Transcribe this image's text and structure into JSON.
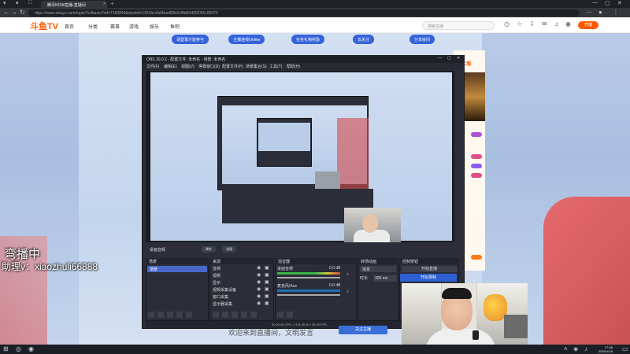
{
  "browser": {
    "tab_title": "腾讯NOW直播-直播间",
    "url": "https://www.douyu.com/topic/Yulibaxiu?rid=7183849&dyshid=1261bcc5d4bad92b2e9fd60d0023f1c00070",
    "new_tab_symbol": "+",
    "close_symbol": "×"
  },
  "site": {
    "logo": "斗鱼TV",
    "nav": [
      "首页",
      "分类",
      "赛事",
      "游戏",
      "娱乐",
      "鱼吧"
    ],
    "search_placeholder": "搜索主播",
    "live_button": "开播"
  },
  "room_tabs": [
    "请登录才能参与",
    "主播连线Online",
    "任务礼物奖励",
    "去关注",
    "分享房间"
  ],
  "right_panel": {
    "pc_label": "PC版"
  },
  "overlay": {
    "line1": "弯播中",
    "line2": "助理v：xiaozhuli66888"
  },
  "bottom": {
    "text": "欢迎来到直播间，文明发言",
    "button": "关注主播"
  },
  "obs": {
    "title": "OBS 30.0.2 - 配置文件: 未命名 - 场景: 未命名",
    "menu": [
      "文件(F)",
      "编辑(E)",
      "视图(V)",
      "停靠窗口(D)",
      "配置文件(P)",
      "场景集合(S)",
      "工具(T)",
      "帮助(H)"
    ],
    "strip_label": "桌面音频",
    "strip_buttons": [
      "属性",
      "滤镜"
    ],
    "docks": {
      "scenes": {
        "title": "场景",
        "items": [
          "场景"
        ]
      },
      "sources": {
        "title": "来源",
        "items": [
          "音频",
          "视频",
          "显示",
          "视频采集设备",
          "窗口采集",
          "显示器采集"
        ]
      },
      "mixer": {
        "title": "混音器",
        "channels": [
          {
            "name": "桌面音频",
            "db": "0.0 dB"
          },
          {
            "name": "麦克风/Aux",
            "db": "0.0 dB"
          }
        ]
      },
      "transitions": {
        "title": "转场动画",
        "value": "渐变",
        "duration_label": "时长",
        "duration": "300 ms"
      },
      "controls": {
        "title": "控制按钮",
        "buttons": [
          "开始直播",
          "开始录制"
        ]
      }
    },
    "status": "00:00:00  CPU: 2.1%  30.00 / 30.00 FPS"
  },
  "taskbar": {
    "time": "17:48",
    "date": "2024/1/18"
  }
}
